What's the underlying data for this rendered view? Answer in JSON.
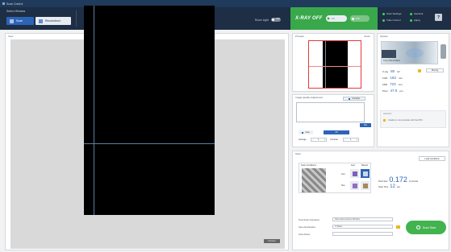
{
  "window": {
    "title": "Scan Control"
  },
  "toolbar": {
    "section_label": "Select Window",
    "modes": [
      {
        "label": "Scan"
      },
      {
        "label": "Reconstruct"
      }
    ],
    "tools": [
      {
        "label": "Load Image",
        "icon": "folder-icon"
      },
      {
        "label": "Management",
        "icon": "management-icon"
      }
    ],
    "room_light_label": "Room Light",
    "room_light_state": "OFF"
  },
  "xray": {
    "status": "X-RAY OFF",
    "on_label": "ON",
    "off_label": "OFF"
  },
  "status": {
    "items": [
      {
        "label": "Scan Settings"
      },
      {
        "label": "Interlock"
      },
      {
        "label": "Tube Current"
      },
      {
        "label": "Aging"
      }
    ],
    "help_label": "?"
  },
  "view": {
    "label": "View",
    "badge": "Preview"
  },
  "preview": {
    "title": "Preview",
    "title_right": "Zoom"
  },
  "system": {
    "title": "System",
    "label_current": "X-ray Tube Position",
    "rows": [
      {
        "label": "X-ray",
        "value": "80",
        "unit": "kV"
      },
      {
        "label": "FOD",
        "value": "163",
        "unit": "mm"
      },
      {
        "label": "FDD",
        "value": "723",
        "unit": "mm"
      },
      {
        "label": "Pixel",
        "value": "47.5",
        "unit": "µm"
      }
    ],
    "moving_label": "Moving",
    "warning_title": "Alert/Info",
    "warning_text": "Unable to communicate with the PPC"
  },
  "iq": {
    "title": "Image Quality Adjustment",
    "contrast_label": "Contrast",
    "set_label": "Set",
    "btn_a": "Auto",
    "btn_b": "All",
    "average_label": "Average",
    "average_value": "1",
    "contrast_step_label": "Contrast",
    "contrast_value": "1"
  },
  "scan": {
    "title": "Scan",
    "load_conditions": "Load conditions",
    "params_label": "Scan Conditions",
    "opt_row1_label": "Axis",
    "opt_row2_label": "Size",
    "tile_header1": "Auto",
    "tile_header2": "Manual",
    "pixel_size_label": "Pixel Size",
    "pixel_size_value": "0.172",
    "pixel_size_unit": "mm/voxel",
    "scan_time_label": "Scan Time",
    "scan_time_value": "12",
    "scan_time_unit": "sec",
    "post_op_label": "Post-Scan Operation",
    "post_op_value": "Show Reconstruct Window",
    "save_dest_label": "Save Destination",
    "save_dest_value": "C:\\Data",
    "scan_name_label": "Scan Name",
    "start_label": "Scan Start"
  },
  "colors": {
    "header": "#1d2e45",
    "accent_blue": "#2c64b8",
    "xray_green": "#39a84b"
  }
}
